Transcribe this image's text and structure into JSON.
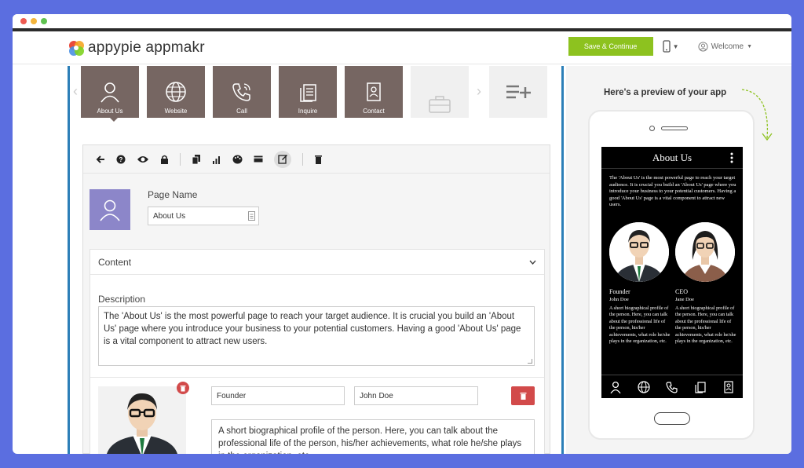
{
  "brand": {
    "name": "appypie appmakr",
    "accent": "#8dc21f"
  },
  "header": {
    "save_label": "Save & Continue",
    "welcome_label": "Welcome"
  },
  "pages": [
    {
      "label": "About Us",
      "icon": "person-icon"
    },
    {
      "label": "Website",
      "icon": "globe-icon"
    },
    {
      "label": "Call",
      "icon": "phone-icon"
    },
    {
      "label": "Inquire",
      "icon": "documents-icon"
    },
    {
      "label": "Contact",
      "icon": "contact-card-icon"
    }
  ],
  "editor": {
    "page_name_label": "Page Name",
    "page_name_value": "About Us",
    "content_label": "Content",
    "description_label": "Description",
    "description_value": "The 'About Us' is the most powerful page to reach your target audience. It is crucial you build an 'About Us' page where you introduce your business to your potential customers. Having a good 'About Us' page is a vital component to attract new users.",
    "member": {
      "role": "Founder",
      "name": "John Doe",
      "bio": "A short biographical profile of the person. Here, you can talk about the professional life of the person, his/her achievements, what role he/she plays in the organization, etc."
    }
  },
  "preview": {
    "title": "Here's a preview of your app",
    "screen_title": "About Us",
    "intro": "The 'About Us' is the most powerful page to reach your target audience. It is crucial you build an 'About Us' page where you introduce your business to your potential customers. Having a good 'About Us' page is a vital component to attract new users.",
    "members": [
      {
        "role": "Founder",
        "name": "John Doe",
        "bio": "A short biographical profile of the person. Here, you can talk about the professional life of the person, his/her achievements, what role he/she plays in the organization, etc."
      },
      {
        "role": "CEO",
        "name": "Jane Doe",
        "bio": "A short biographical profile of the person. Here, you can talk about the professional life of the person, his/her achievements, what role he/she plays in the organization, etc."
      }
    ]
  }
}
